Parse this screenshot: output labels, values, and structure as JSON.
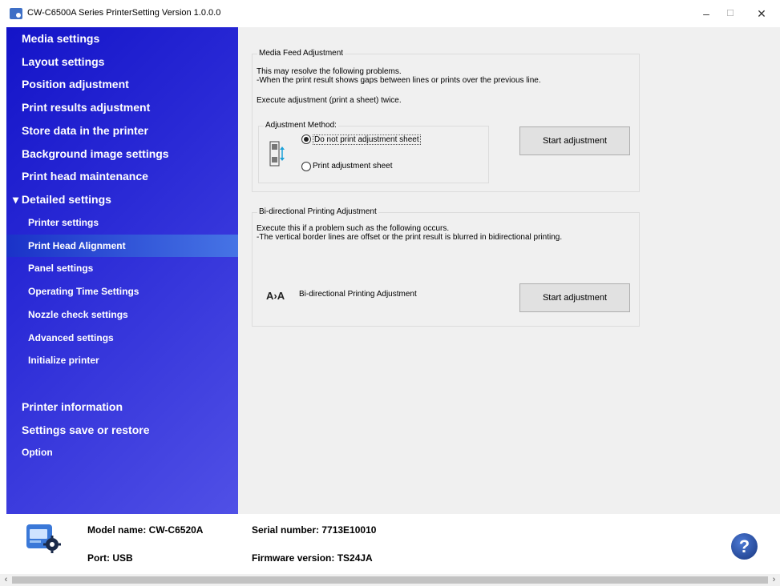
{
  "window": {
    "title": "CW-C6500A Series PrinterSetting Version 1.0.0.0",
    "minimize": "–",
    "maximize": "☐",
    "close": "✕"
  },
  "sidebar": {
    "items": [
      {
        "label": "Media settings"
      },
      {
        "label": "Layout settings"
      },
      {
        "label": "Position adjustment"
      },
      {
        "label": "Print results adjustment"
      },
      {
        "label": "Store data in the printer"
      },
      {
        "label": "Background image settings"
      },
      {
        "label": "Print head maintenance"
      },
      {
        "label": "▾ Detailed settings"
      },
      {
        "label": "Printer settings"
      },
      {
        "label": "Print Head Alignment"
      },
      {
        "label": "Panel settings"
      },
      {
        "label": "Operating Time Settings"
      },
      {
        "label": "Nozzle check settings"
      },
      {
        "label": "Advanced settings"
      },
      {
        "label": "Initialize printer"
      },
      {
        "label": "Printer information"
      },
      {
        "label": "Settings save or restore"
      },
      {
        "label": "Option"
      }
    ],
    "selected": "Print Head Alignment"
  },
  "media_feed": {
    "title": "Media Feed Adjustment",
    "desc1": "This may resolve the following problems.",
    "desc2": " -When the print result shows gaps between lines or prints over the previous line.",
    "desc3": "Execute adjustment (print a sheet) twice.",
    "method_title": "Adjustment Method:",
    "option1": "Do not print adjustment sheet",
    "option2": "Print adjustment sheet",
    "selected_option": "Do not print adjustment sheet",
    "button": "Start adjustment"
  },
  "bidirectional": {
    "title": "Bi-directional Printing Adjustment",
    "desc1": "Execute this if a problem such as the following occurs.",
    "desc2": " -The vertical border lines are offset or the print result is blurred in bidirectional printing.",
    "icon_text": "A›A",
    "label": "Bi-directional Printing Adjustment",
    "button": "Start adjustment"
  },
  "footer": {
    "model": "Model name: CW-C6520A",
    "port": "Port: USB",
    "serial": "Serial number: 7713E10010",
    "firmware": "Firmware version: TS24JA",
    "help": "?"
  },
  "scrollbar": {
    "left": "‹",
    "right": "›"
  },
  "colors": {
    "sidebar": "#1f1fcf",
    "selected": "#4a7ae8",
    "panel": "#f0f0f0"
  }
}
